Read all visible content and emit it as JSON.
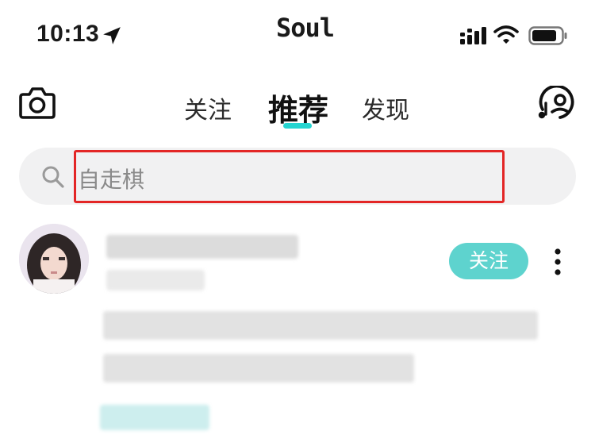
{
  "status_bar": {
    "time": "10:13",
    "app_title": "Soul",
    "icons": [
      "location-arrow-icon",
      "cellular-signal-icon",
      "wifi-icon",
      "battery-icon"
    ]
  },
  "header": {
    "left_icon": "camera-icon",
    "tabs": [
      {
        "label": "关注",
        "active": false
      },
      {
        "label": "推荐",
        "active": true
      },
      {
        "label": "发现",
        "active": false
      }
    ],
    "right_icon": "music-person-icon",
    "accent_color": "#25d4d0"
  },
  "search": {
    "icon": "search-icon",
    "placeholder": "自走棋",
    "highlight_color": "#e32626"
  },
  "post": {
    "follow_label": "关注",
    "follow_color": "#5ed3ce",
    "more_icon": "more-vertical-icon"
  }
}
